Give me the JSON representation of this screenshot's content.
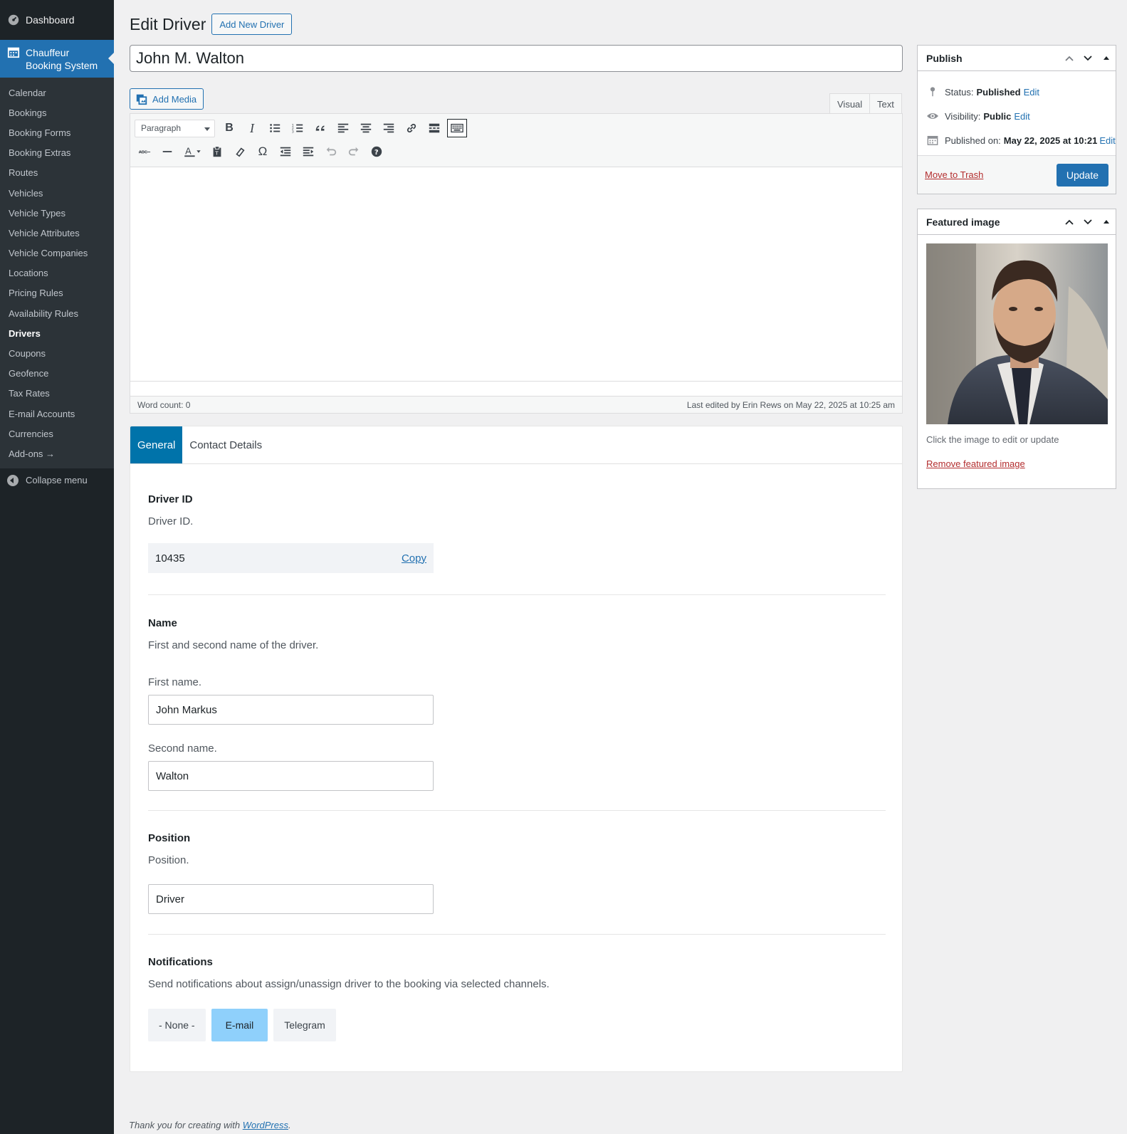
{
  "sidebar": {
    "dashboard": "Dashboard",
    "current": "Chauffeur Booking System",
    "items": [
      {
        "label": "Calendar"
      },
      {
        "label": "Bookings"
      },
      {
        "label": "Booking Forms"
      },
      {
        "label": "Booking Extras"
      },
      {
        "label": "Routes"
      },
      {
        "label": "Vehicles"
      },
      {
        "label": "Vehicle Types"
      },
      {
        "label": "Vehicle Attributes"
      },
      {
        "label": "Vehicle Companies"
      },
      {
        "label": "Locations"
      },
      {
        "label": "Pricing Rules"
      },
      {
        "label": "Availability Rules"
      },
      {
        "label": "Drivers"
      },
      {
        "label": "Coupons"
      },
      {
        "label": "Geofence"
      },
      {
        "label": "Tax Rates"
      },
      {
        "label": "E-mail Accounts"
      },
      {
        "label": "Currencies"
      },
      {
        "label": "Add-ons →"
      }
    ],
    "collapse": "Collapse menu"
  },
  "header": {
    "title": "Edit Driver",
    "add_new": "Add New Driver"
  },
  "post_title": "John M. Walton",
  "editor": {
    "add_media": "Add Media",
    "tab_visual": "Visual",
    "tab_text": "Text",
    "format_select": "Paragraph",
    "word_count": "Word count: 0",
    "last_edited": "Last edited by Erin Rews on May 22, 2025 at 10:25 am"
  },
  "tabs": {
    "general": "General",
    "contact": "Contact Details"
  },
  "driver_id": {
    "title": "Driver ID",
    "desc": "Driver ID.",
    "value": "10435",
    "copy": "Copy"
  },
  "name": {
    "title": "Name",
    "desc": "First and second name of the driver.",
    "first_label": "First name.",
    "first_value": "John Markus",
    "second_label": "Second name.",
    "second_value": "Walton"
  },
  "position": {
    "title": "Position",
    "desc": "Position.",
    "value": "Driver"
  },
  "notifications": {
    "title": "Notifications",
    "desc": "Send notifications about assign/unassign driver to the booking via selected channels.",
    "options": [
      "- None -",
      "E-mail",
      "Telegram"
    ],
    "selected": "E-mail"
  },
  "publish": {
    "title": "Publish",
    "status_label": "Status:",
    "status_value": "Published",
    "visibility_label": "Visibility:",
    "visibility_value": "Public",
    "published_label": "Published on:",
    "published_value": "May 22, 2025 at 10:21",
    "edit": "Edit",
    "trash": "Move to Trash",
    "update": "Update"
  },
  "featured": {
    "title": "Featured image",
    "hint": "Click the image to edit or update",
    "remove": "Remove featured image"
  },
  "footer": {
    "text": "Thank you for creating with",
    "link": "WordPress",
    "end": "."
  },
  "colors": {
    "admin_blue": "#2271b1",
    "sidebar_bg": "#1d2327",
    "tab_active": "#0073aa",
    "choice_selected": "#8fd0fb",
    "danger": "#b32d2e"
  }
}
